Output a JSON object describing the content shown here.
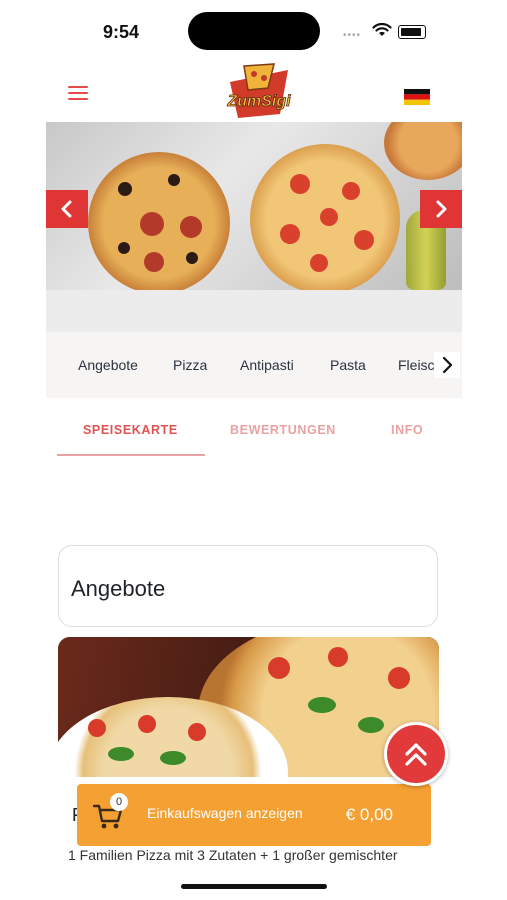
{
  "status_bar": {
    "time": "9:54"
  },
  "header": {
    "logo_text": "ZumSigi",
    "language_flag": "de"
  },
  "hero": {
    "prev_icon": "chevron-left-icon",
    "next_icon": "chevron-right-icon"
  },
  "categories": [
    {
      "label": "Angebote"
    },
    {
      "label": "Pizza"
    },
    {
      "label": "Antipasti"
    },
    {
      "label": "Pasta"
    },
    {
      "label": "Fleisc"
    }
  ],
  "tabs": [
    {
      "label": "SPEISEKARTE"
    },
    {
      "label": "BEWERTUNGEN"
    },
    {
      "label": "INFO"
    }
  ],
  "section": {
    "title": "Angebote"
  },
  "offer": {
    "title_initial": "F",
    "description": "1 Familien Pizza mit 3 Zutaten + 1 großer gemischter"
  },
  "cart": {
    "count": "0",
    "label": "Einkaufswagen anzeigen",
    "total": "€ 0,00"
  },
  "colors": {
    "accent_red": "#e03535",
    "tab_active": "#e05353",
    "cart_orange": "#f5a033"
  }
}
